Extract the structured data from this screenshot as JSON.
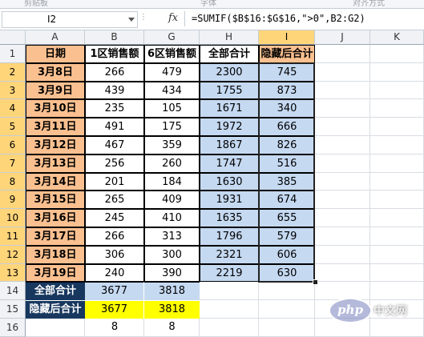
{
  "ribbon": {
    "groups": [
      "剪贴板",
      "字体",
      "对齐方式"
    ]
  },
  "formula_bar": {
    "name_box": "I2",
    "fx": "fx",
    "formula": "=SUMIF($B$16:$G$16,\">0\",B2:G2)"
  },
  "columns": [
    "A",
    "B",
    "G",
    "H",
    "I",
    "J",
    "K"
  ],
  "rows": [
    "1",
    "2",
    "3",
    "4",
    "5",
    "6",
    "7",
    "8",
    "9",
    "10",
    "11",
    "12",
    "13",
    "14",
    "15",
    "16"
  ],
  "header": {
    "date": "日期",
    "zone1": "1区销售额",
    "zone6": "6区销售额",
    "total": "全部合计",
    "hidden_total": "隐藏后合计"
  },
  "data_rows": [
    {
      "date": "3月8日",
      "b": "266",
      "g": "479",
      "h": "2300",
      "i": "745"
    },
    {
      "date": "3月9日",
      "b": "439",
      "g": "434",
      "h": "1755",
      "i": "873"
    },
    {
      "date": "3月10日",
      "b": "235",
      "g": "105",
      "h": "1671",
      "i": "340"
    },
    {
      "date": "3月11日",
      "b": "491",
      "g": "175",
      "h": "1972",
      "i": "666"
    },
    {
      "date": "3月12日",
      "b": "467",
      "g": "359",
      "h": "1867",
      "i": "826"
    },
    {
      "date": "3月13日",
      "b": "256",
      "g": "260",
      "h": "1747",
      "i": "516"
    },
    {
      "date": "3月14日",
      "b": "201",
      "g": "184",
      "h": "1630",
      "i": "385"
    },
    {
      "date": "3月15日",
      "b": "265",
      "g": "409",
      "h": "1931",
      "i": "674"
    },
    {
      "date": "3月16日",
      "b": "245",
      "g": "410",
      "h": "1635",
      "i": "655"
    },
    {
      "date": "3月17日",
      "b": "266",
      "g": "313",
      "h": "1796",
      "i": "579"
    },
    {
      "date": "3月18日",
      "b": "306",
      "g": "300",
      "h": "2321",
      "i": "606"
    },
    {
      "date": "3月19日",
      "b": "240",
      "g": "390",
      "h": "2219",
      "i": "630"
    }
  ],
  "summary": {
    "all_total_label": "全部合计",
    "all_total_b": "3677",
    "all_total_g": "3818",
    "hidden_total_label": "隐藏后合计",
    "hidden_total_b": "3677",
    "hidden_total_g": "3818",
    "row16_b": "8",
    "row16_g": "8"
  },
  "watermark": {
    "text": "php 中文网"
  },
  "colors": {
    "date_fill": "#fac090",
    "header_fill": "#fac090",
    "total_fill": "#c5d9f1",
    "hidden_fill": "#c5d9f1",
    "yellow": "#ffff00",
    "selected_header": "#ffd57a"
  }
}
